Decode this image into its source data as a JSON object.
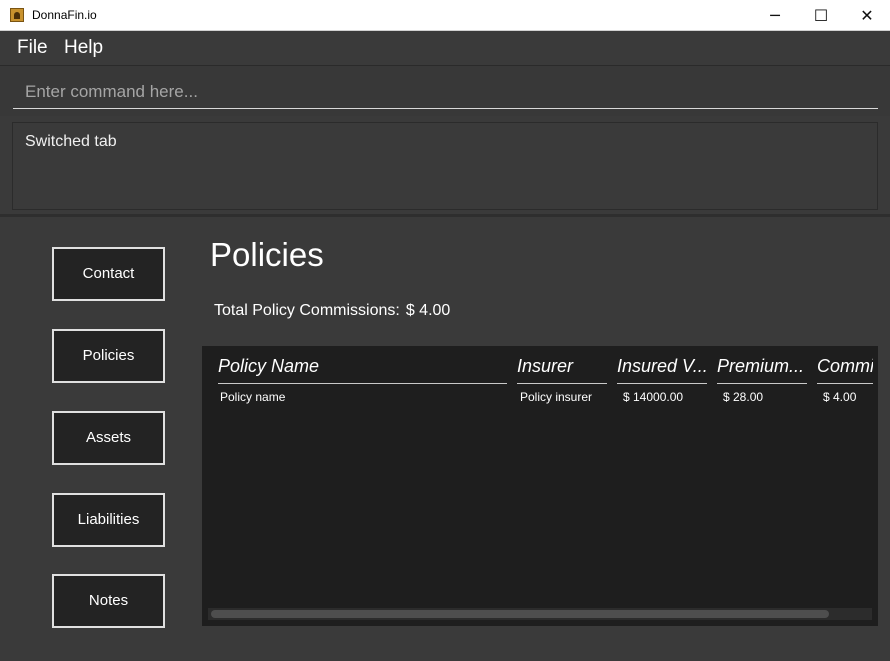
{
  "window": {
    "title": "DonnaFin.io",
    "minimize_icon": "─",
    "maximize_icon": "☐",
    "close_icon": "✕"
  },
  "menu": {
    "items": [
      "File",
      "Help"
    ]
  },
  "command": {
    "placeholder": "Enter command here...",
    "value": ""
  },
  "result": {
    "text": "Switched tab"
  },
  "sidebar": {
    "tabs": [
      "Contact",
      "Policies",
      "Assets",
      "Liabilities",
      "Notes"
    ]
  },
  "main": {
    "title": "Policies",
    "commission_label": "Total Policy Commissions:",
    "commission_value": "$ 4.00",
    "table": {
      "headers": [
        "Policy Name",
        "Insurer",
        "Insured V...",
        "Premium...",
        "Commi"
      ],
      "rows": [
        [
          "Policy name",
          "Policy insurer",
          "$ 14000.00",
          "$ 28.00",
          "$ 4.00"
        ]
      ]
    }
  }
}
